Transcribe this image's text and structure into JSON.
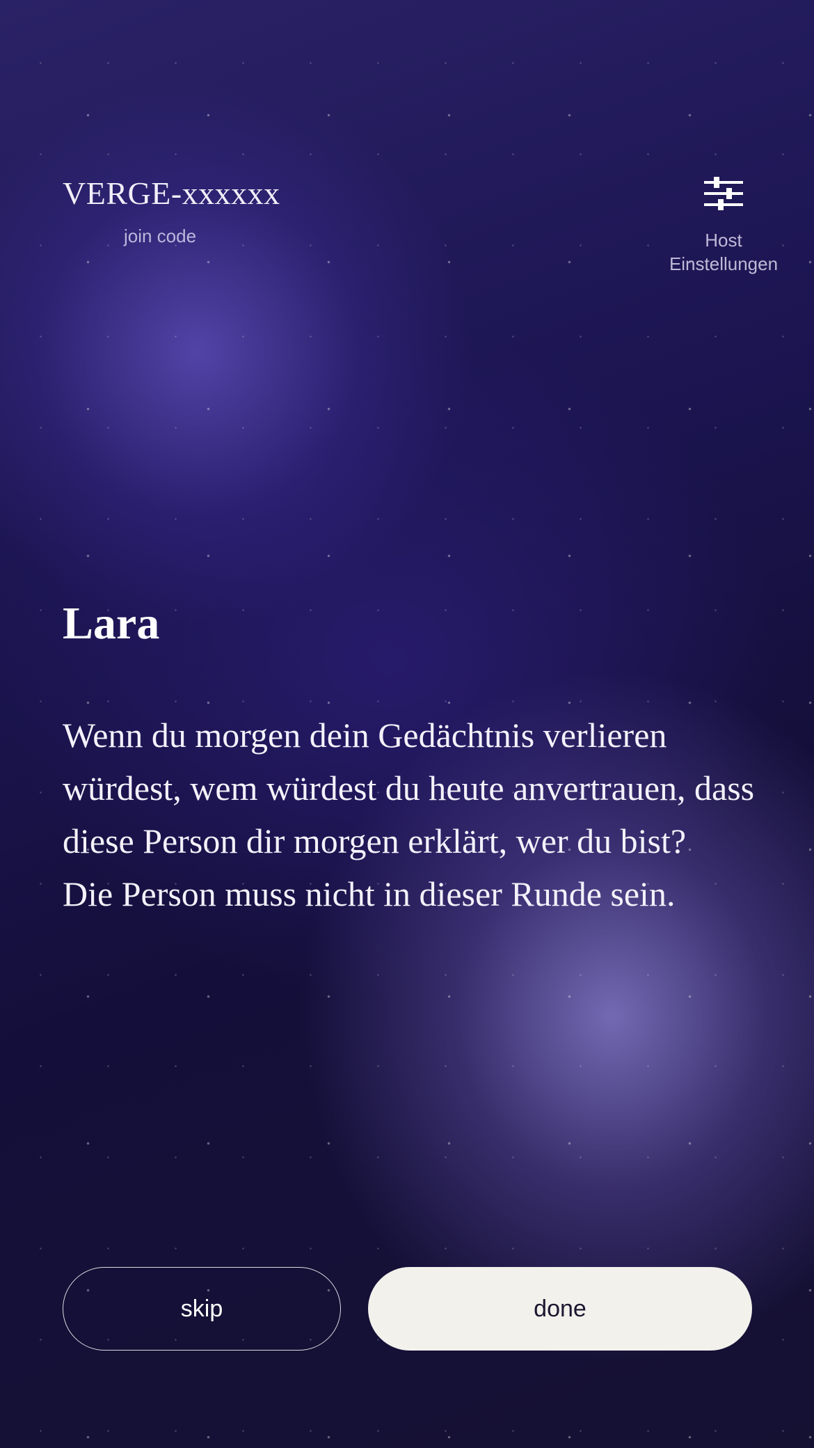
{
  "header": {
    "join_code": "VERGE-xxxxxx",
    "join_label": "join code",
    "host_settings": {
      "icon": "sliders-icon",
      "label_line1": "Host",
      "label_line2": "Einstellungen"
    }
  },
  "main": {
    "player_name": "Lara",
    "question_line1": "Wenn du morgen dein Gedächtnis verlieren würdest, wem würdest du heute anvertrauen, dass diese Person dir morgen erklärt, wer du bist?",
    "question_line2": "Die Person muss nicht in dieser Runde sein."
  },
  "actions": {
    "skip_label": "skip",
    "done_label": "done"
  },
  "colors": {
    "background_dark": "#140f3a",
    "background_glow": "#5a4bb4",
    "done_button_bg": "#f3f1ec",
    "text": "#ffffff"
  }
}
